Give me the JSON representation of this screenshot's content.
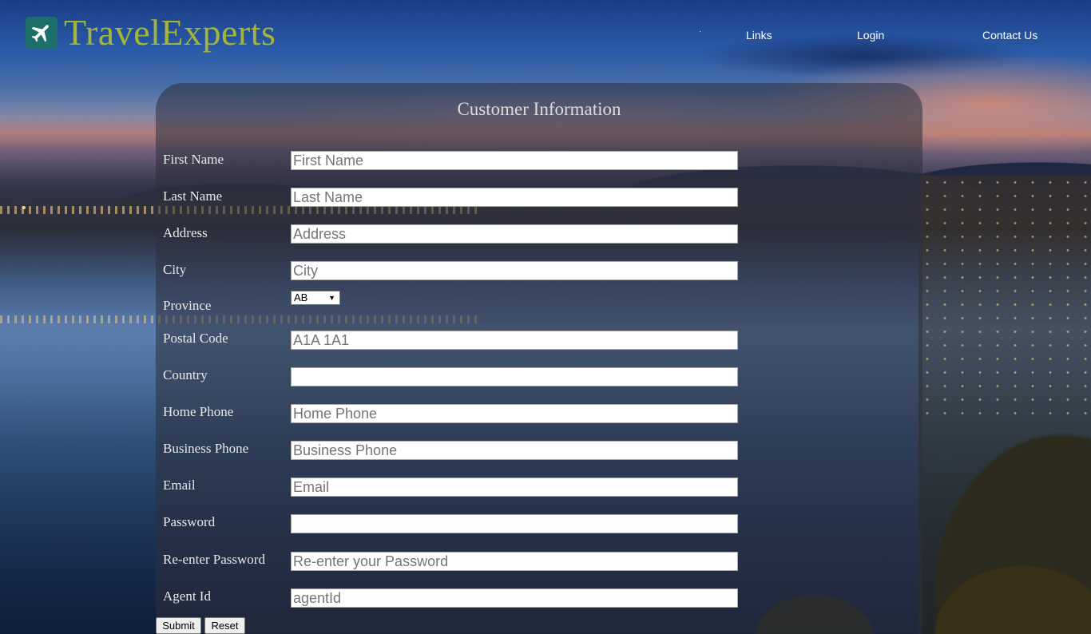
{
  "brand": {
    "name": "TravelExperts"
  },
  "nav": {
    "items": [
      {
        "label": "Links"
      },
      {
        "label": "Login"
      },
      {
        "label": "Contact Us"
      }
    ]
  },
  "form": {
    "title": "Customer Information",
    "fields": {
      "first_name": {
        "label": "First Name",
        "placeholder": "First Name",
        "value": ""
      },
      "last_name": {
        "label": "Last Name",
        "placeholder": "Last Name",
        "value": ""
      },
      "address": {
        "label": "Address",
        "placeholder": "Address",
        "value": ""
      },
      "city": {
        "label": "City",
        "placeholder": "City",
        "value": ""
      },
      "province": {
        "label": "Province",
        "value": "AB"
      },
      "postal_code": {
        "label": "Postal Code",
        "placeholder": "A1A 1A1",
        "value": ""
      },
      "country": {
        "label": "Country",
        "placeholder": "",
        "value": ""
      },
      "home_phone": {
        "label": "Home Phone",
        "placeholder": "Home Phone",
        "value": ""
      },
      "business_phone": {
        "label": "Business Phone",
        "placeholder": "Business Phone",
        "value": ""
      },
      "email": {
        "label": "Email",
        "placeholder": "Email",
        "value": ""
      },
      "password": {
        "label": "Password",
        "placeholder": "",
        "value": ""
      },
      "reenter_password": {
        "label": "Re-enter Password",
        "placeholder": "Re-enter your Password",
        "value": ""
      },
      "agent_id": {
        "label": "Agent Id",
        "placeholder": "agentId",
        "value": ""
      }
    },
    "submit_label": "Submit",
    "reset_label": "Reset"
  },
  "colors": {
    "brand_text": "#a3b63c",
    "brand_icon_bg": "#1d6f6a",
    "panel_bg": "rgba(45,48,60,0.55)"
  }
}
